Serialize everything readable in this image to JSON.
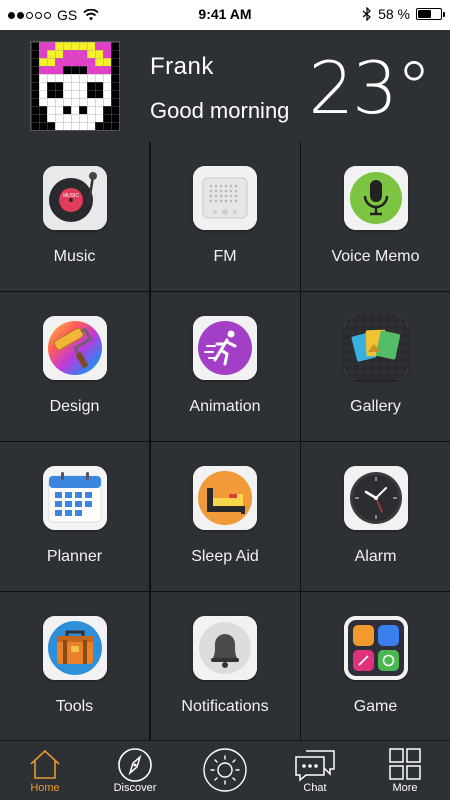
{
  "status_bar": {
    "carrier": "GS",
    "signal_bars": 2,
    "time": "9:41 AM",
    "battery_text": "58 %",
    "battery_level": 0.58
  },
  "header": {
    "name": "Frank",
    "greeting": "Good morning",
    "temperature": "23°"
  },
  "tiles": [
    {
      "label": "Music",
      "icon": "music-record-icon"
    },
    {
      "label": "FM",
      "icon": "radio-icon"
    },
    {
      "label": "Voice Memo",
      "icon": "microphone-icon"
    },
    {
      "label": "Design",
      "icon": "paint-roller-icon"
    },
    {
      "label": "Animation",
      "icon": "running-person-icon"
    },
    {
      "label": "Gallery",
      "icon": "photo-cards-icon"
    },
    {
      "label": "Planner",
      "icon": "calendar-icon"
    },
    {
      "label": "Sleep Aid",
      "icon": "bed-icon"
    },
    {
      "label": "Alarm",
      "icon": "clock-icon"
    },
    {
      "label": "Tools",
      "icon": "toolbox-icon"
    },
    {
      "label": "Notifications",
      "icon": "bell-icon"
    },
    {
      "label": "Game",
      "icon": "game-grid-icon"
    }
  ],
  "music_icon_text": "MUSIC",
  "tabbar": [
    {
      "label": "Home",
      "icon": "home-icon",
      "active": true
    },
    {
      "label": "Discover",
      "icon": "compass-icon",
      "active": false
    },
    {
      "label": "",
      "icon": "sun-icon",
      "active": false
    },
    {
      "label": "Chat",
      "icon": "chat-icon",
      "active": false
    },
    {
      "label": "More",
      "icon": "more-grid-icon",
      "active": false
    }
  ],
  "colors": {
    "background": "#2d3035",
    "divider": "#101114",
    "active_tab": "#e89a2c"
  }
}
